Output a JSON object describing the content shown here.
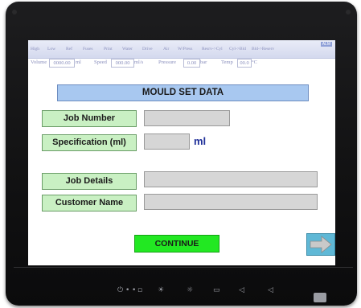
{
  "header": {
    "labels": [
      "High",
      "Low",
      "Ref",
      "Fuses",
      "Print",
      "Water",
      "Drive",
      "Air",
      "W/Press",
      "Resrv->Cyl",
      "Cyl->Bld",
      "Bld->Reserv"
    ],
    "alm": "ALM",
    "volume_label": "Volume",
    "volume_value": "0000.00",
    "volume_unit": "ml",
    "speed_label": "Speed",
    "speed_value": "000.00",
    "speed_unit": "ml/s",
    "pressure_label": "Pressure",
    "pressure_value": "0.00",
    "pressure_unit": "bar",
    "temp_label": "Temp",
    "temp_value": "00.0",
    "temp_unit": "°C"
  },
  "page_title": "MOULD SET DATA",
  "fields": {
    "job_number_label": "Job Number",
    "job_number_value": "",
    "specification_label": "Specification (ml)",
    "specification_value": "",
    "specification_unit": "ml",
    "job_details_label": "Job Details",
    "job_details_value": "",
    "customer_name_label": "Customer Name",
    "customer_name_value": ""
  },
  "continue_label": "CONTINUE",
  "colors": {
    "title_bg": "#a8c8f0",
    "label_bg": "#c9f0c3",
    "input_bg": "#d6d6d6",
    "continue_bg": "#22e822",
    "arrow_bg": "#5fb8d6",
    "bezel": "#111112"
  },
  "bezel_keys": [
    "power-icon",
    "dot-icon",
    "dot-icon",
    "square-icon",
    "brightness-up-icon",
    "brightness-down-icon",
    "menu-icon",
    "volume-up-icon",
    "volume-down-icon",
    "touch-disable-icon"
  ]
}
